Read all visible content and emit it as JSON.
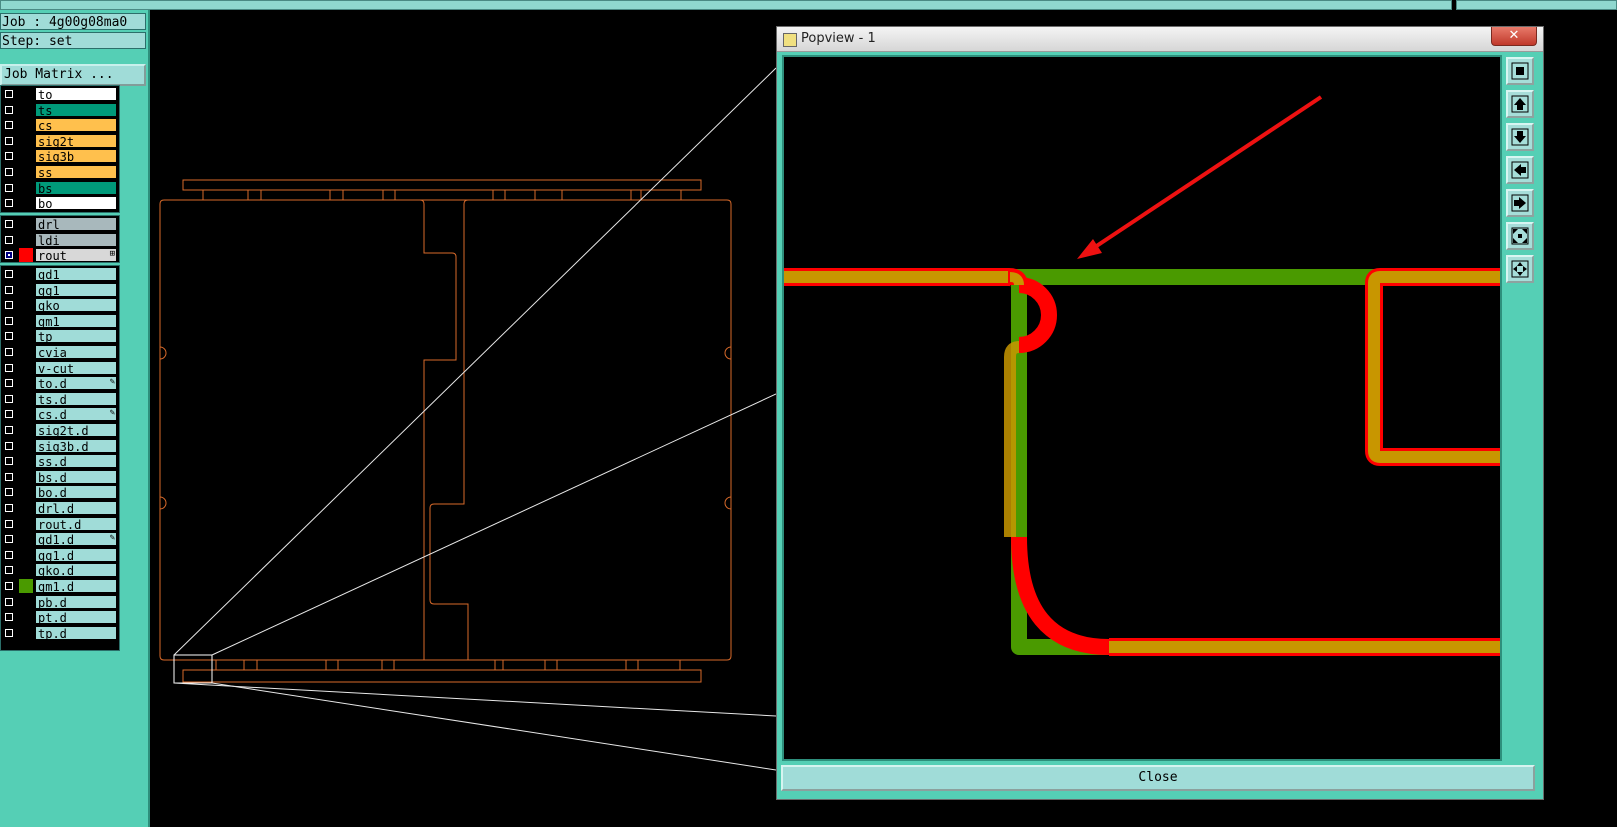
{
  "job_label": "Job : 4g00g08ma0",
  "step_label": "Step: set",
  "job_matrix_button": "Job Matrix ...",
  "layers": {
    "board": [
      {
        "name": "to",
        "bg": "#ffffff"
      },
      {
        "name": "ts",
        "bg": "#009a7a"
      },
      {
        "name": "cs",
        "bg": "#ffc04d"
      },
      {
        "name": "sig2t",
        "bg": "#ffc04d"
      },
      {
        "name": "sig3b",
        "bg": "#ffc04d"
      },
      {
        "name": "ss",
        "bg": "#ffc04d"
      },
      {
        "name": "bs",
        "bg": "#009a7a"
      },
      {
        "name": "bo",
        "bg": "#ffffff"
      }
    ],
    "drill": [
      {
        "name": "drl",
        "bg": "#a8b8bc"
      },
      {
        "name": "ldi",
        "bg": "#a8b8bc"
      },
      {
        "name": "rout",
        "bg": "#d8d8d8",
        "swatch": "#ff0000",
        "checked": true,
        "indicator": "⊞"
      }
    ],
    "misc": [
      {
        "name": "gd1",
        "bg": "#a0dcd8"
      },
      {
        "name": "gg1",
        "bg": "#a0dcd8"
      },
      {
        "name": "gko",
        "bg": "#a0dcd8"
      },
      {
        "name": "gm1",
        "bg": "#a0dcd8"
      },
      {
        "name": "tp",
        "bg": "#a0dcd8"
      },
      {
        "name": "cvia",
        "bg": "#a0dcd8"
      },
      {
        "name": "v-cut",
        "bg": "#a0dcd8"
      },
      {
        "name": "to.d",
        "bg": "#a0dcd8",
        "indicator": "✎"
      },
      {
        "name": "ts.d",
        "bg": "#a0dcd8"
      },
      {
        "name": "cs.d",
        "bg": "#a0dcd8",
        "indicator": "✎"
      },
      {
        "name": "sig2t.d",
        "bg": "#a0dcd8"
      },
      {
        "name": "sig3b.d",
        "bg": "#a0dcd8"
      },
      {
        "name": "ss.d",
        "bg": "#a0dcd8"
      },
      {
        "name": "bs.d",
        "bg": "#a0dcd8"
      },
      {
        "name": "bo.d",
        "bg": "#a0dcd8"
      },
      {
        "name": "drl.d",
        "bg": "#a0dcd8"
      },
      {
        "name": "rout.d",
        "bg": "#a0dcd8"
      },
      {
        "name": "gd1.d",
        "bg": "#a0dcd8",
        "indicator": "✎"
      },
      {
        "name": "gg1.d",
        "bg": "#a0dcd8"
      },
      {
        "name": "gko.d",
        "bg": "#a0dcd8"
      },
      {
        "name": "gm1.d",
        "bg": "#a0dcd8",
        "swatch": "#4a9a00"
      },
      {
        "name": "pb.d",
        "bg": "#a0dcd8"
      },
      {
        "name": "pt.d",
        "bg": "#a0dcd8"
      },
      {
        "name": "tp.d",
        "bg": "#a0dcd8"
      }
    ]
  },
  "popview": {
    "title": "Popview - 1",
    "close_x": "✕",
    "close_button": "Close",
    "tools": [
      "zoom-fit-icon",
      "pan-up-icon",
      "pan-down-icon",
      "pan-left-icon",
      "pan-right-icon",
      "zoom-out-icon",
      "zoom-home-icon"
    ]
  },
  "colors": {
    "outline": "#d86a2a",
    "route_red": "#ff0000",
    "route_green": "#4a9a00",
    "route_gold": "#c89600",
    "arrow": "#ee1111",
    "panel": "#55cfb5"
  }
}
